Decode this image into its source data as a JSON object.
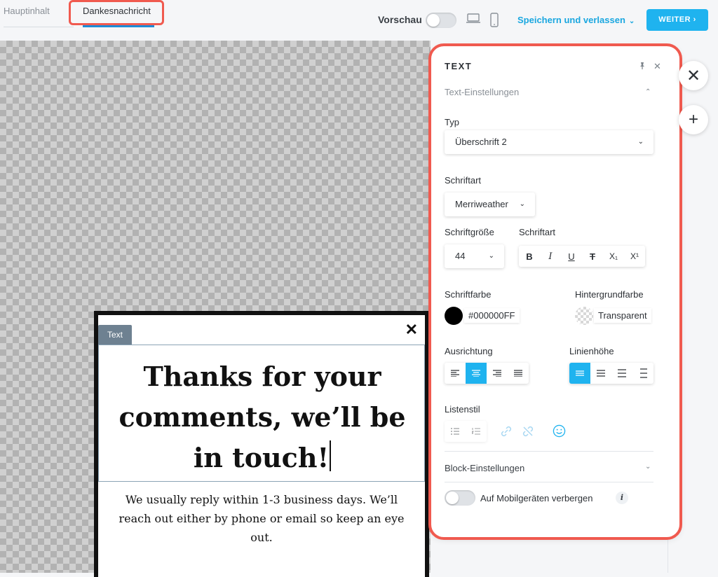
{
  "tabs": {
    "main": "Hauptinhalt",
    "thanks": "Dankesnachricht"
  },
  "toolbar": {
    "preview_label": "Vorschau",
    "save_leave": "Speichern und verlassen",
    "next": "WEITER",
    "next_chevron": "›"
  },
  "popup": {
    "chip": "Text",
    "close": "✕",
    "heading_lines": [
      "Thanks for your",
      "comments, we’ll be",
      "in touch!"
    ],
    "body_lines": [
      "We usually reply within 1-3 business days. We’ll",
      "reach out either by phone or email so keep an eye",
      "out."
    ]
  },
  "panel": {
    "title": "TEXT",
    "close": "✕",
    "text_settings": "Text-Einstellungen",
    "type_label": "Typ",
    "type_value": "Überschrift 2",
    "font_label": "Schriftart",
    "font_value": "Merriweather",
    "size_label": "Schriftgröße",
    "size_value": "44",
    "style_label": "Schriftart",
    "style_buttons": [
      "B",
      "I",
      "U",
      "T",
      "X₁",
      "X¹"
    ],
    "color_label": "Schriftfarbe",
    "color_value": "#000000FF",
    "bg_label": "Hintergrundfarbe",
    "bg_value": "Transparent",
    "align_label": "Ausrichtung",
    "lineheight_label": "Linienhöhe",
    "list_label": "Listenstil",
    "block_settings": "Block-Einstellungen",
    "mobile_hide": "Auf Mobilgeräten verbergen",
    "info": "i"
  },
  "floating": {
    "close": "✕",
    "add": "+"
  },
  "colors": {
    "accent": "#1fb3ef",
    "highlight": "#f05a4f",
    "text_color_swatch": "#000000"
  }
}
